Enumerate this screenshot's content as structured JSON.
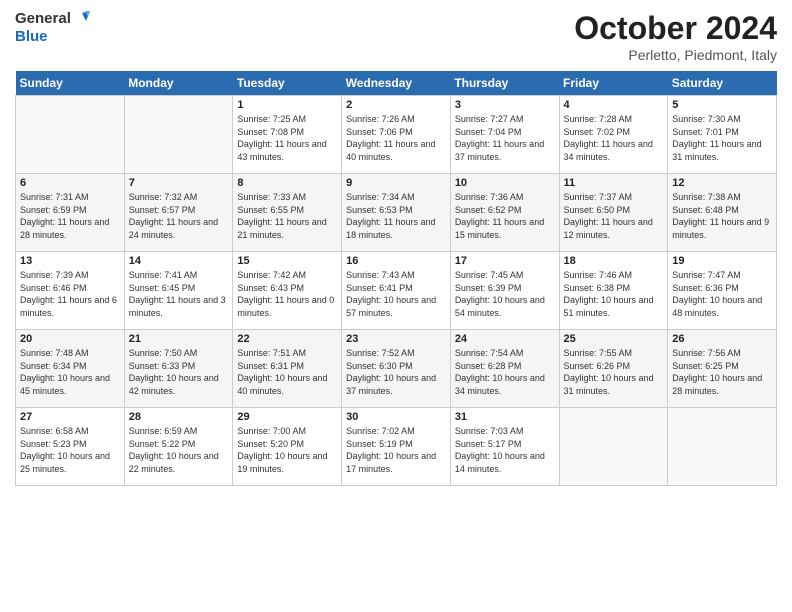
{
  "header": {
    "logo_line1": "General",
    "logo_line2": "Blue",
    "month": "October 2024",
    "location": "Perletto, Piedmont, Italy"
  },
  "days_of_week": [
    "Sunday",
    "Monday",
    "Tuesday",
    "Wednesday",
    "Thursday",
    "Friday",
    "Saturday"
  ],
  "weeks": [
    [
      {
        "day": "",
        "info": ""
      },
      {
        "day": "",
        "info": ""
      },
      {
        "day": "1",
        "info": "Sunrise: 7:25 AM\nSunset: 7:08 PM\nDaylight: 11 hours and 43 minutes."
      },
      {
        "day": "2",
        "info": "Sunrise: 7:26 AM\nSunset: 7:06 PM\nDaylight: 11 hours and 40 minutes."
      },
      {
        "day": "3",
        "info": "Sunrise: 7:27 AM\nSunset: 7:04 PM\nDaylight: 11 hours and 37 minutes."
      },
      {
        "day": "4",
        "info": "Sunrise: 7:28 AM\nSunset: 7:02 PM\nDaylight: 11 hours and 34 minutes."
      },
      {
        "day": "5",
        "info": "Sunrise: 7:30 AM\nSunset: 7:01 PM\nDaylight: 11 hours and 31 minutes."
      }
    ],
    [
      {
        "day": "6",
        "info": "Sunrise: 7:31 AM\nSunset: 6:59 PM\nDaylight: 11 hours and 28 minutes."
      },
      {
        "day": "7",
        "info": "Sunrise: 7:32 AM\nSunset: 6:57 PM\nDaylight: 11 hours and 24 minutes."
      },
      {
        "day": "8",
        "info": "Sunrise: 7:33 AM\nSunset: 6:55 PM\nDaylight: 11 hours and 21 minutes."
      },
      {
        "day": "9",
        "info": "Sunrise: 7:34 AM\nSunset: 6:53 PM\nDaylight: 11 hours and 18 minutes."
      },
      {
        "day": "10",
        "info": "Sunrise: 7:36 AM\nSunset: 6:52 PM\nDaylight: 11 hours and 15 minutes."
      },
      {
        "day": "11",
        "info": "Sunrise: 7:37 AM\nSunset: 6:50 PM\nDaylight: 11 hours and 12 minutes."
      },
      {
        "day": "12",
        "info": "Sunrise: 7:38 AM\nSunset: 6:48 PM\nDaylight: 11 hours and 9 minutes."
      }
    ],
    [
      {
        "day": "13",
        "info": "Sunrise: 7:39 AM\nSunset: 6:46 PM\nDaylight: 11 hours and 6 minutes."
      },
      {
        "day": "14",
        "info": "Sunrise: 7:41 AM\nSunset: 6:45 PM\nDaylight: 11 hours and 3 minutes."
      },
      {
        "day": "15",
        "info": "Sunrise: 7:42 AM\nSunset: 6:43 PM\nDaylight: 11 hours and 0 minutes."
      },
      {
        "day": "16",
        "info": "Sunrise: 7:43 AM\nSunset: 6:41 PM\nDaylight: 10 hours and 57 minutes."
      },
      {
        "day": "17",
        "info": "Sunrise: 7:45 AM\nSunset: 6:39 PM\nDaylight: 10 hours and 54 minutes."
      },
      {
        "day": "18",
        "info": "Sunrise: 7:46 AM\nSunset: 6:38 PM\nDaylight: 10 hours and 51 minutes."
      },
      {
        "day": "19",
        "info": "Sunrise: 7:47 AM\nSunset: 6:36 PM\nDaylight: 10 hours and 48 minutes."
      }
    ],
    [
      {
        "day": "20",
        "info": "Sunrise: 7:48 AM\nSunset: 6:34 PM\nDaylight: 10 hours and 45 minutes."
      },
      {
        "day": "21",
        "info": "Sunrise: 7:50 AM\nSunset: 6:33 PM\nDaylight: 10 hours and 42 minutes."
      },
      {
        "day": "22",
        "info": "Sunrise: 7:51 AM\nSunset: 6:31 PM\nDaylight: 10 hours and 40 minutes."
      },
      {
        "day": "23",
        "info": "Sunrise: 7:52 AM\nSunset: 6:30 PM\nDaylight: 10 hours and 37 minutes."
      },
      {
        "day": "24",
        "info": "Sunrise: 7:54 AM\nSunset: 6:28 PM\nDaylight: 10 hours and 34 minutes."
      },
      {
        "day": "25",
        "info": "Sunrise: 7:55 AM\nSunset: 6:26 PM\nDaylight: 10 hours and 31 minutes."
      },
      {
        "day": "26",
        "info": "Sunrise: 7:56 AM\nSunset: 6:25 PM\nDaylight: 10 hours and 28 minutes."
      }
    ],
    [
      {
        "day": "27",
        "info": "Sunrise: 6:58 AM\nSunset: 5:23 PM\nDaylight: 10 hours and 25 minutes."
      },
      {
        "day": "28",
        "info": "Sunrise: 6:59 AM\nSunset: 5:22 PM\nDaylight: 10 hours and 22 minutes."
      },
      {
        "day": "29",
        "info": "Sunrise: 7:00 AM\nSunset: 5:20 PM\nDaylight: 10 hours and 19 minutes."
      },
      {
        "day": "30",
        "info": "Sunrise: 7:02 AM\nSunset: 5:19 PM\nDaylight: 10 hours and 17 minutes."
      },
      {
        "day": "31",
        "info": "Sunrise: 7:03 AM\nSunset: 5:17 PM\nDaylight: 10 hours and 14 minutes."
      },
      {
        "day": "",
        "info": ""
      },
      {
        "day": "",
        "info": ""
      }
    ]
  ]
}
